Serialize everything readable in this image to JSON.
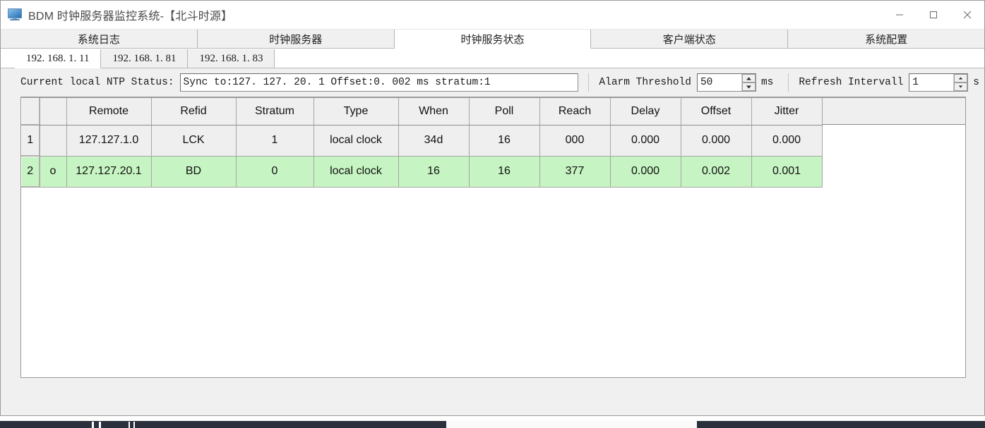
{
  "window": {
    "title": "BDM 时钟服务器监控系统-【北斗时源】",
    "icon": "monitor-icon",
    "minimize_label": "minimize",
    "maximize_label": "maximize",
    "close_label": "close"
  },
  "tabs": [
    {
      "label": "系统日志",
      "active": false
    },
    {
      "label": "时钟服务器",
      "active": false
    },
    {
      "label": "时钟服务状态",
      "active": true
    },
    {
      "label": "客户端状态",
      "active": false
    },
    {
      "label": "系统配置",
      "active": false
    }
  ],
  "subtabs": [
    {
      "label": "192. 168. 1. 11",
      "active": true
    },
    {
      "label": "192. 168. 1. 81",
      "active": false
    },
    {
      "label": "192. 168. 1. 83",
      "active": false
    }
  ],
  "status": {
    "label": "Current local NTP Status:",
    "value": "Sync to:127. 127. 20. 1   Offset:0. 002 ms   stratum:1",
    "alarm_label": "Alarm Threshold",
    "alarm_value": "50",
    "alarm_unit": "ms",
    "refresh_label": "Refresh Intervall",
    "refresh_value": "1",
    "refresh_unit": "s"
  },
  "table": {
    "headers": [
      "Remote",
      "Refid",
      "Stratum",
      "Type",
      "When",
      "Poll",
      "Reach",
      "Delay",
      "Offset",
      "Jitter"
    ],
    "rows": [
      {
        "index": "1",
        "flag": "",
        "highlight": false,
        "cells": [
          "127.127.1.0",
          "LCK",
          "1",
          "local clock",
          "34d",
          "16",
          "000",
          "0.000",
          "0.000",
          "0.000"
        ]
      },
      {
        "index": "2",
        "flag": "o",
        "highlight": true,
        "cells": [
          "127.127.20.1",
          "BD",
          "0",
          "local clock",
          "16",
          "16",
          "377",
          "0.000",
          "0.002",
          "0.001"
        ]
      }
    ]
  },
  "colors": {
    "highlight_row": "#c6f4c2",
    "header_bg": "#efefef",
    "window_bg": "#f0f0f0",
    "accent_icon": "#4f93cf"
  }
}
